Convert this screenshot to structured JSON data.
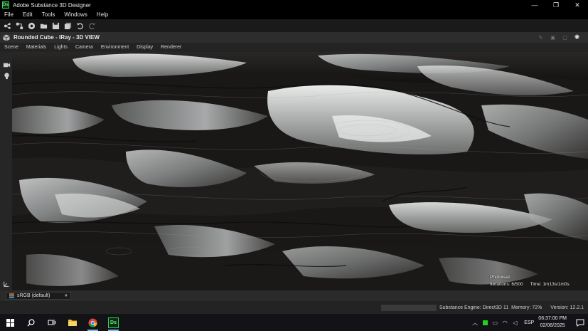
{
  "window": {
    "title": "Adobe Substance 3D Designer",
    "logo_text": "Ds"
  },
  "window_controls": {
    "minimize": "—",
    "restore": "❐",
    "close": "✕"
  },
  "menu": [
    "File",
    "Edit",
    "Tools",
    "Windows",
    "Help"
  ],
  "toolbar": {
    "icons": [
      "new-graph-icon",
      "new-mdl-icon",
      "new-substance-icon",
      "open-folder-icon",
      "save-icon",
      "save-all-icon",
      "undo-icon",
      "redo-icon"
    ]
  },
  "panel": {
    "title": "Rounded Cube - IRay - 3D VIEW"
  },
  "view_menu": [
    "Scene",
    "Materials",
    "Lights",
    "Camera",
    "Environment",
    "Display",
    "Renderer"
  ],
  "viewport": {
    "mode": "Photoreal",
    "iterations": "Iterations: 6/500",
    "time": "Time: 1m13s/1m0s"
  },
  "color_space": {
    "selected": "sRGB (default)"
  },
  "status": {
    "engine": "Substance Engine: Direct3D 11",
    "memory": "Memory: 72%",
    "version": "Version: 12.2.1"
  },
  "taskbar": {
    "apps": [
      "windows-start-icon",
      "search-icon",
      "task-view-icon",
      "file-explorer-icon",
      "chrome-icon",
      "substance-designer-icon"
    ],
    "designer_label": "Ds",
    "language": "ESP",
    "time": "06:37:00 PM",
    "date": "02/06/2025"
  }
}
